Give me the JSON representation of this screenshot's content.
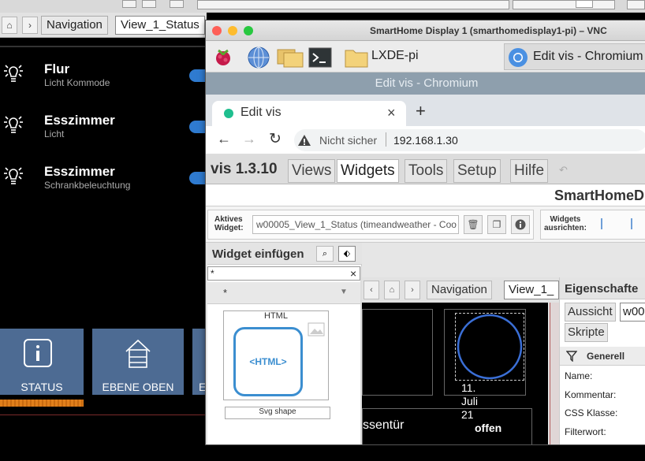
{
  "background": {
    "nav": {
      "tab_navigation": "Navigation",
      "tab_view": "View_1_Status"
    },
    "lights": [
      {
        "title": "Flur",
        "subtitle": "Licht Kommode"
      },
      {
        "title": "Esszimmer",
        "subtitle": "Licht"
      },
      {
        "title": "Esszimmer",
        "subtitle": "Schrankbeleuchtung"
      }
    ],
    "tiles": [
      {
        "label": "STATUS",
        "icon": "info-icon"
      },
      {
        "label": "EBENE OBEN",
        "icon": "house-icon"
      },
      {
        "label": "E",
        "icon": ""
      }
    ]
  },
  "vnc": {
    "title": "SmartHome Display 1 (smarthomedisplay1-pi) – VNC",
    "taskbar": {
      "folder_label": "LXDE-pi",
      "chromium_label": "Edit vis - Chromium"
    },
    "chrome_window_title": "Edit vis - Chromium",
    "tab_title": "Edit vis",
    "tab_close": "×",
    "new_tab": "+",
    "address_security": "Nicht sicher",
    "address_url": "192.168.1.30",
    "vis": {
      "brand": "vis 1.3.10",
      "menu": [
        "Views",
        "Widgets",
        "Tools",
        "Setup",
        "Hilfe"
      ],
      "header_title": "SmartHomeD",
      "active_widget_label_1": "Aktives",
      "active_widget_label_2": "Widget:",
      "active_widget_value": "w00005_View_1_Status (timeandweather - Coo",
      "align_label_1": "Widgets",
      "align_label_2": "ausrichten:",
      "insert_title": "Widget einfügen",
      "filter_value": "*",
      "filter_clear": "×",
      "category_value": "*",
      "widget_html_title": "HTML",
      "widget_html_text": "<HTML>",
      "widget_svg_title": "Svg shape",
      "center_nav": "Navigation",
      "center_view": "View_1_",
      "canvas_date_1": "11.",
      "canvas_date_2": "Juli",
      "canvas_date_3": "21",
      "canvas_door": "ssentür",
      "canvas_state": "offen",
      "props_title": "Eigenschafte",
      "props_tab_view": "Aussicht",
      "props_tab_id": "w00",
      "props_tab_scripts": "Skripte",
      "props_section": "Generell",
      "props_name": "Name:",
      "props_comment": "Kommentar:",
      "props_css": "CSS Klasse:",
      "props_filter": "Filterwort:"
    }
  },
  "colors": {
    "accent_blue": "#2f7bd0",
    "tile_blue": "#4d6b93",
    "orange": "#e07f1b",
    "chrome_titlebar": "#8e9fad"
  }
}
